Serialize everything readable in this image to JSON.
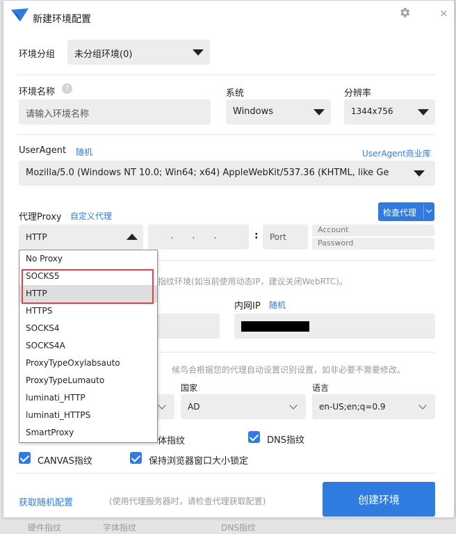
{
  "window": {
    "title": "新建环境配置",
    "close_label": "×"
  },
  "group": {
    "label": "环境分组",
    "value": "未分组环境(0)"
  },
  "name": {
    "label": "环境名称",
    "help": "?",
    "placeholder": "请输入环境名称"
  },
  "system": {
    "label": "系统",
    "value": "Windows"
  },
  "resolution": {
    "label": "分辨率",
    "value": "1344x756"
  },
  "useragent": {
    "label": "UserAgent",
    "random_link": "随机",
    "library_link": "UserAgent商业库",
    "value": "Mozilla/5.0 (Windows NT 10.0; Win64; x64) AppleWebKit/537.36 (KHTML, like Ge"
  },
  "proxy": {
    "label": "代理Proxy",
    "custom_link": "自定义代理",
    "check_button": "检查代理",
    "type_value": "HTTP",
    "ip_dots": ".      .      .",
    "colon": ":",
    "port_placeholder": "Port",
    "account_placeholder": "Account",
    "password_placeholder": "Password",
    "options": [
      "No Proxy",
      "SOCKS5",
      "HTTP",
      "HTTPS",
      "SOCKS4",
      "SOCKS4A",
      "ProxyTypeOxylabsauto",
      "ProxyTypeLumauto",
      "luminati_HTTP",
      "luminati_HTTPS",
      "SmartProxy"
    ],
    "selected_option": "HTTP"
  },
  "webrtc_hint": "指纹环境(如当前使用动态IP，建议关闭WebRTC)。",
  "intranet": {
    "label": "内网IP",
    "random_link": "随机",
    "value_masked": ""
  },
  "geo_hint": "候鸟会根据您的代理自动设置识别设置，如非必要不需要修改。",
  "country": {
    "label": "国家",
    "value": "AD"
  },
  "language": {
    "label": "语言",
    "value": "en-US;en;q=0.9"
  },
  "checkboxes": {
    "font_partial": "体指纹",
    "dns": "DNS指纹",
    "canvas": "CANVAS指纹",
    "window_lock": "保持浏览器窗口大小锁定"
  },
  "footer": {
    "random_config_link": "获取随机配置",
    "hint": "(使用代理服务器时，请检查代理获取配置)",
    "create_button": "创建环境"
  },
  "background_text": {
    "bottom_left": "硬件指纹",
    "bottom_mid": "字体指纹",
    "bottom_right": "DNS指纹"
  },
  "colors": {
    "accent": "#2f7be0",
    "field_bg": "#ededed",
    "highlight_border": "#e8404a",
    "selected_bg": "#dedede"
  }
}
